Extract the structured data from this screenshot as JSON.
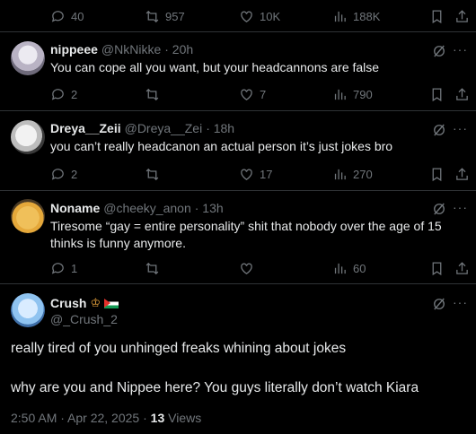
{
  "top_actions": {
    "replies": "40",
    "reposts": "957",
    "likes": "10K",
    "views": "188K"
  },
  "replies": [
    {
      "name": "nippeee",
      "handle": "@NkNikke",
      "time": "· 20h",
      "text": "You can cope all you want, but your headcannons are false",
      "replies": "2",
      "reposts": "",
      "likes": "7",
      "views": "790"
    },
    {
      "name": "Dreya__Zeii",
      "handle": "@Dreya__Zei",
      "time": "· 18h",
      "text": "you can’t really headcanon an actual person it’s just jokes bro",
      "replies": "2",
      "reposts": "",
      "likes": "17",
      "views": "270"
    },
    {
      "name": "Noname",
      "handle": "@cheeky_anon",
      "time": "· 13h",
      "text": "Tiresome “gay = entire personality” shit that nobody over the age of 15 thinks is funny anymore.",
      "replies": "1",
      "reposts": "",
      "likes": "",
      "views": "60"
    }
  ],
  "main_post": {
    "name": "Crush",
    "handle": "@_Crush_2",
    "line1": "really tired of you unhinged freaks whining about jokes",
    "line2": "why are you and Nippee here? You guys literally don’t watch Kiara",
    "timestamp": "2:50 AM · Apr 22, 2025 ·",
    "views_count": "13",
    "views_label": "Views"
  },
  "more_label": "···",
  "colors": {
    "background": "#000000",
    "text": "#e7e9ea",
    "muted": "#71767b",
    "divider": "#2f3336"
  }
}
